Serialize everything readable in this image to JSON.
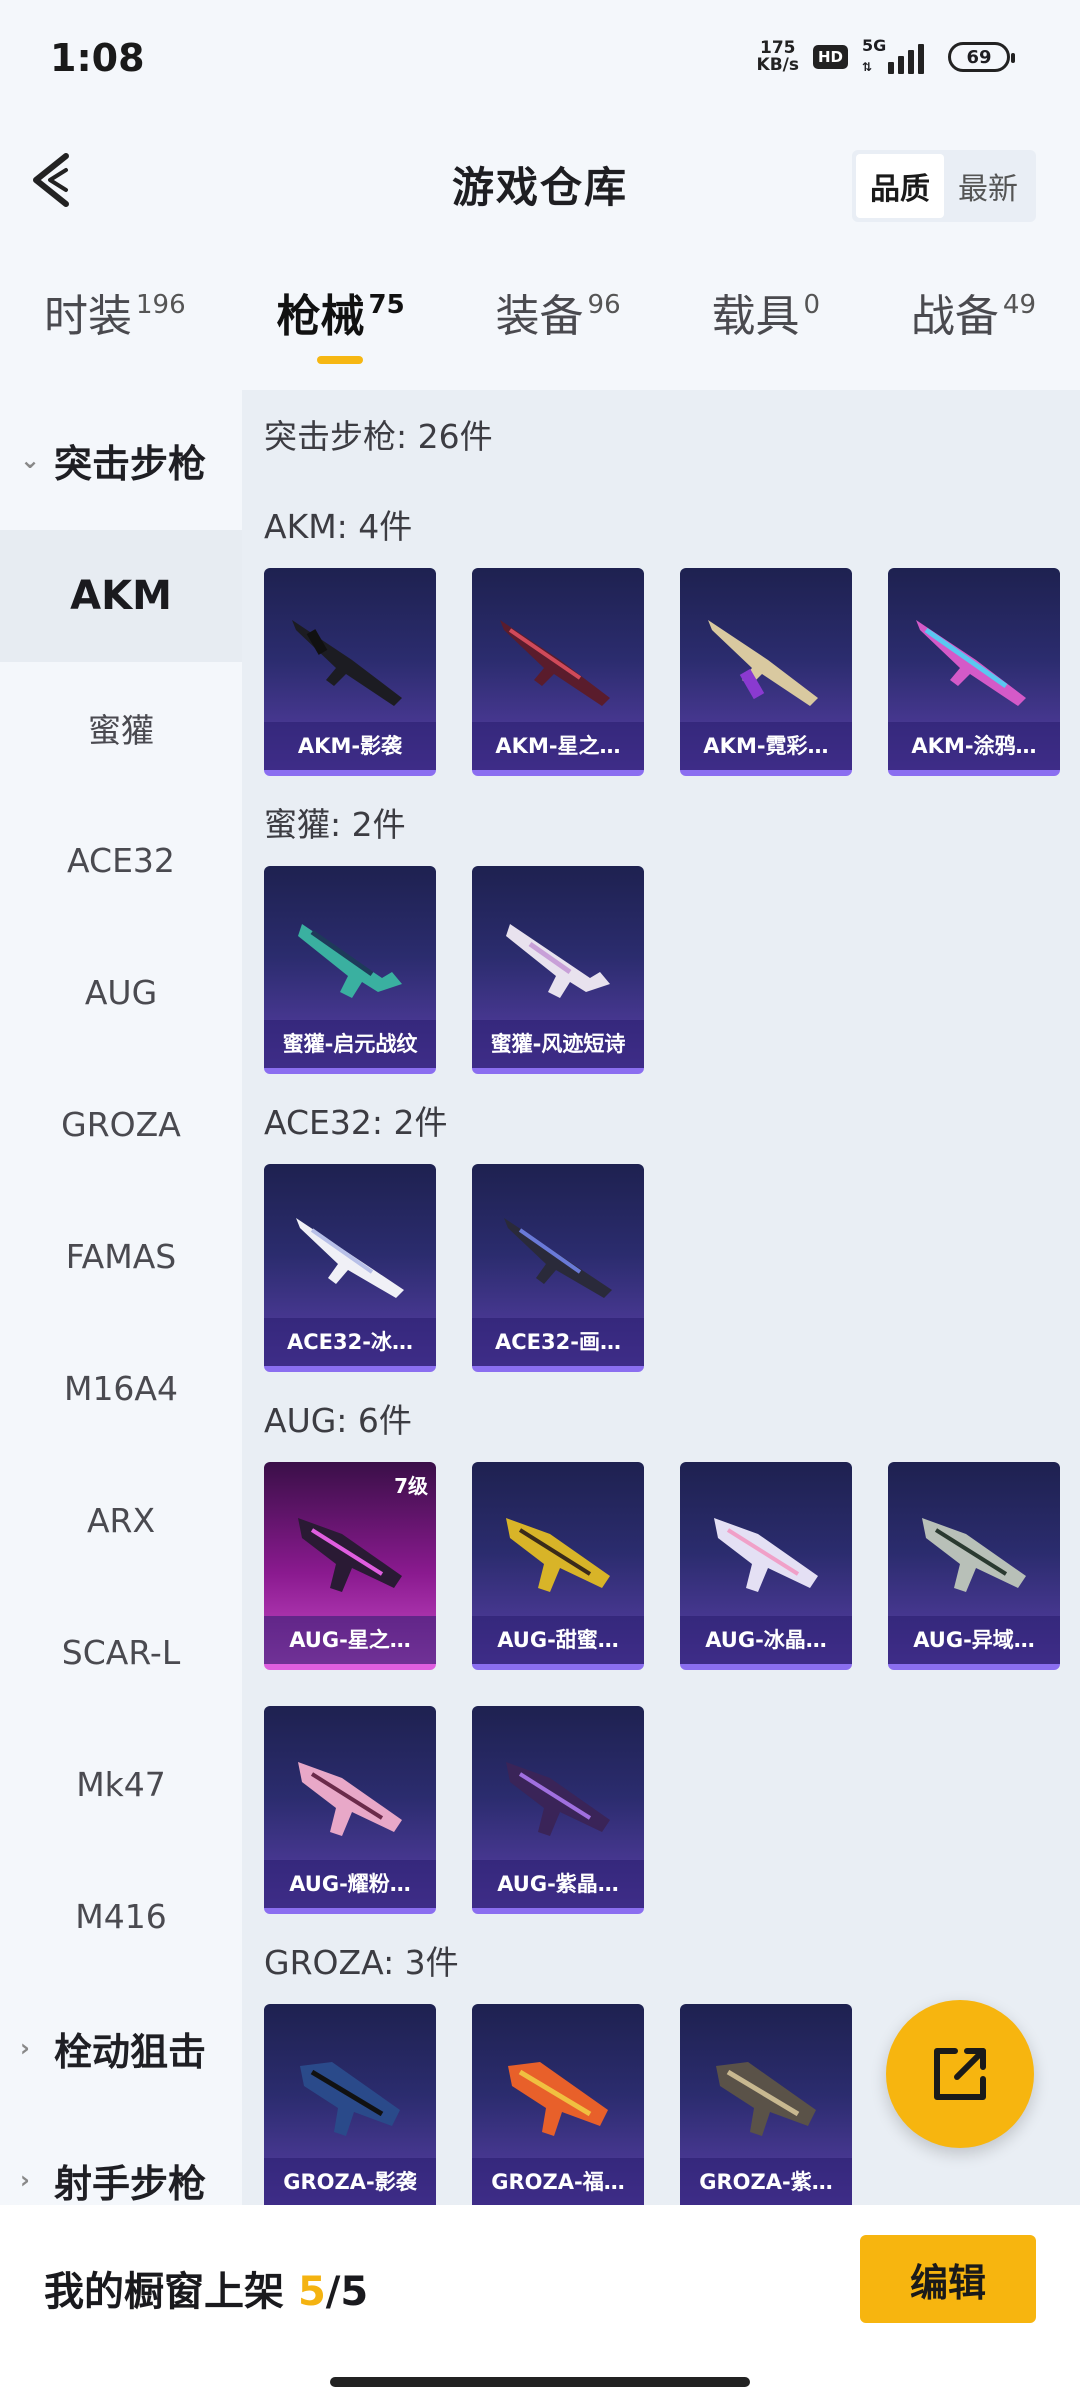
{
  "status": {
    "time": "1:08",
    "net_speed_value": "175",
    "net_speed_unit": "KB/s",
    "hd": "HD",
    "network": "5G",
    "battery": "69"
  },
  "header": {
    "title": "游戏仓库",
    "sort_options": [
      "品质",
      "最新"
    ],
    "sort_selected": "品质"
  },
  "tabs": [
    {
      "label": "时装",
      "count": "196"
    },
    {
      "label": "枪械",
      "count": "75"
    },
    {
      "label": "装备",
      "count": "96"
    },
    {
      "label": "载具",
      "count": "0"
    },
    {
      "label": "战备",
      "count": "49"
    }
  ],
  "sidebar": {
    "groups": [
      {
        "label": "突击步枪",
        "expanded": true
      },
      {
        "label": "栓动狙击",
        "expanded": false
      },
      {
        "label": "射手步枪",
        "expanded": false
      }
    ],
    "items": [
      "AKM",
      "蜜獾",
      "ACE32",
      "AUG",
      "GROZA",
      "FAMAS",
      "M16A4",
      "ARX",
      "SCAR-L",
      "Mk47",
      "M416"
    ],
    "selected": "AKM"
  },
  "content": {
    "summary": "突击步枪: 26件",
    "sections": [
      {
        "title": "AKM: 4件",
        "items": [
          "AKM-影袭",
          "AKM-星之…",
          "AKM-霓彩…",
          "AKM-涂鸦…"
        ]
      },
      {
        "title": "蜜獾: 2件",
        "items": [
          "蜜獾-启元战纹",
          "蜜獾-风迹短诗"
        ]
      },
      {
        "title": "ACE32: 2件",
        "items": [
          "ACE32-冰…",
          "ACE32-画…"
        ]
      },
      {
        "title": "AUG: 6件",
        "items": [
          "AUG-星之…",
          "AUG-甜蜜…",
          "AUG-冰晶…",
          "AUG-异域…",
          "AUG-耀粉…",
          "AUG-紫晶…"
        ]
      },
      {
        "title": "GROZA: 3件",
        "items": [
          "GROZA-影袭",
          "GROZA-福…",
          "GROZA-紫…"
        ]
      }
    ],
    "badges": {
      "aug_level": "7级"
    }
  },
  "colors": {
    "accent": "#f7b50f",
    "card_top": "#1e2150",
    "card_bottom": "#5a3fa8",
    "card_highlight": "#c84ac8"
  },
  "bottom": {
    "label": "我的橱窗上架",
    "count_current": "5",
    "count_sep": "/",
    "count_total": "5",
    "edit_label": "编辑"
  }
}
